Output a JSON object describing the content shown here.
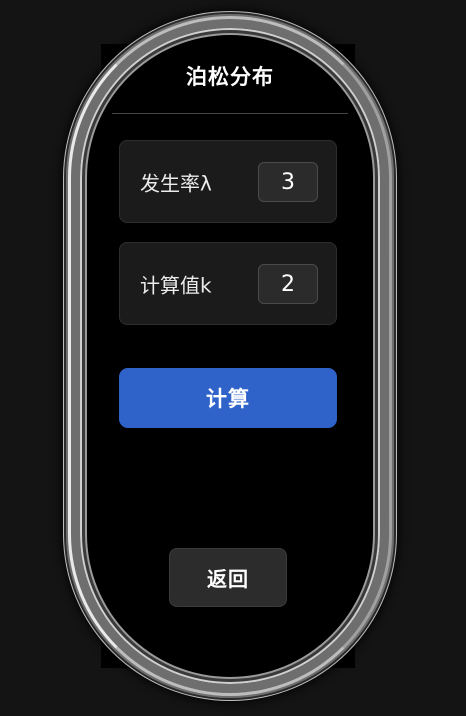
{
  "header": {
    "title": "泊松分布"
  },
  "params": {
    "rate": {
      "label": "发生率λ",
      "value": "3"
    },
    "k": {
      "label": "计算值k",
      "value": "2"
    }
  },
  "actions": {
    "calculate_label": "计算",
    "back_label": "返回"
  },
  "colors": {
    "accent": "#2f63c9",
    "background": "#000000",
    "card": "#1b1b1b"
  }
}
